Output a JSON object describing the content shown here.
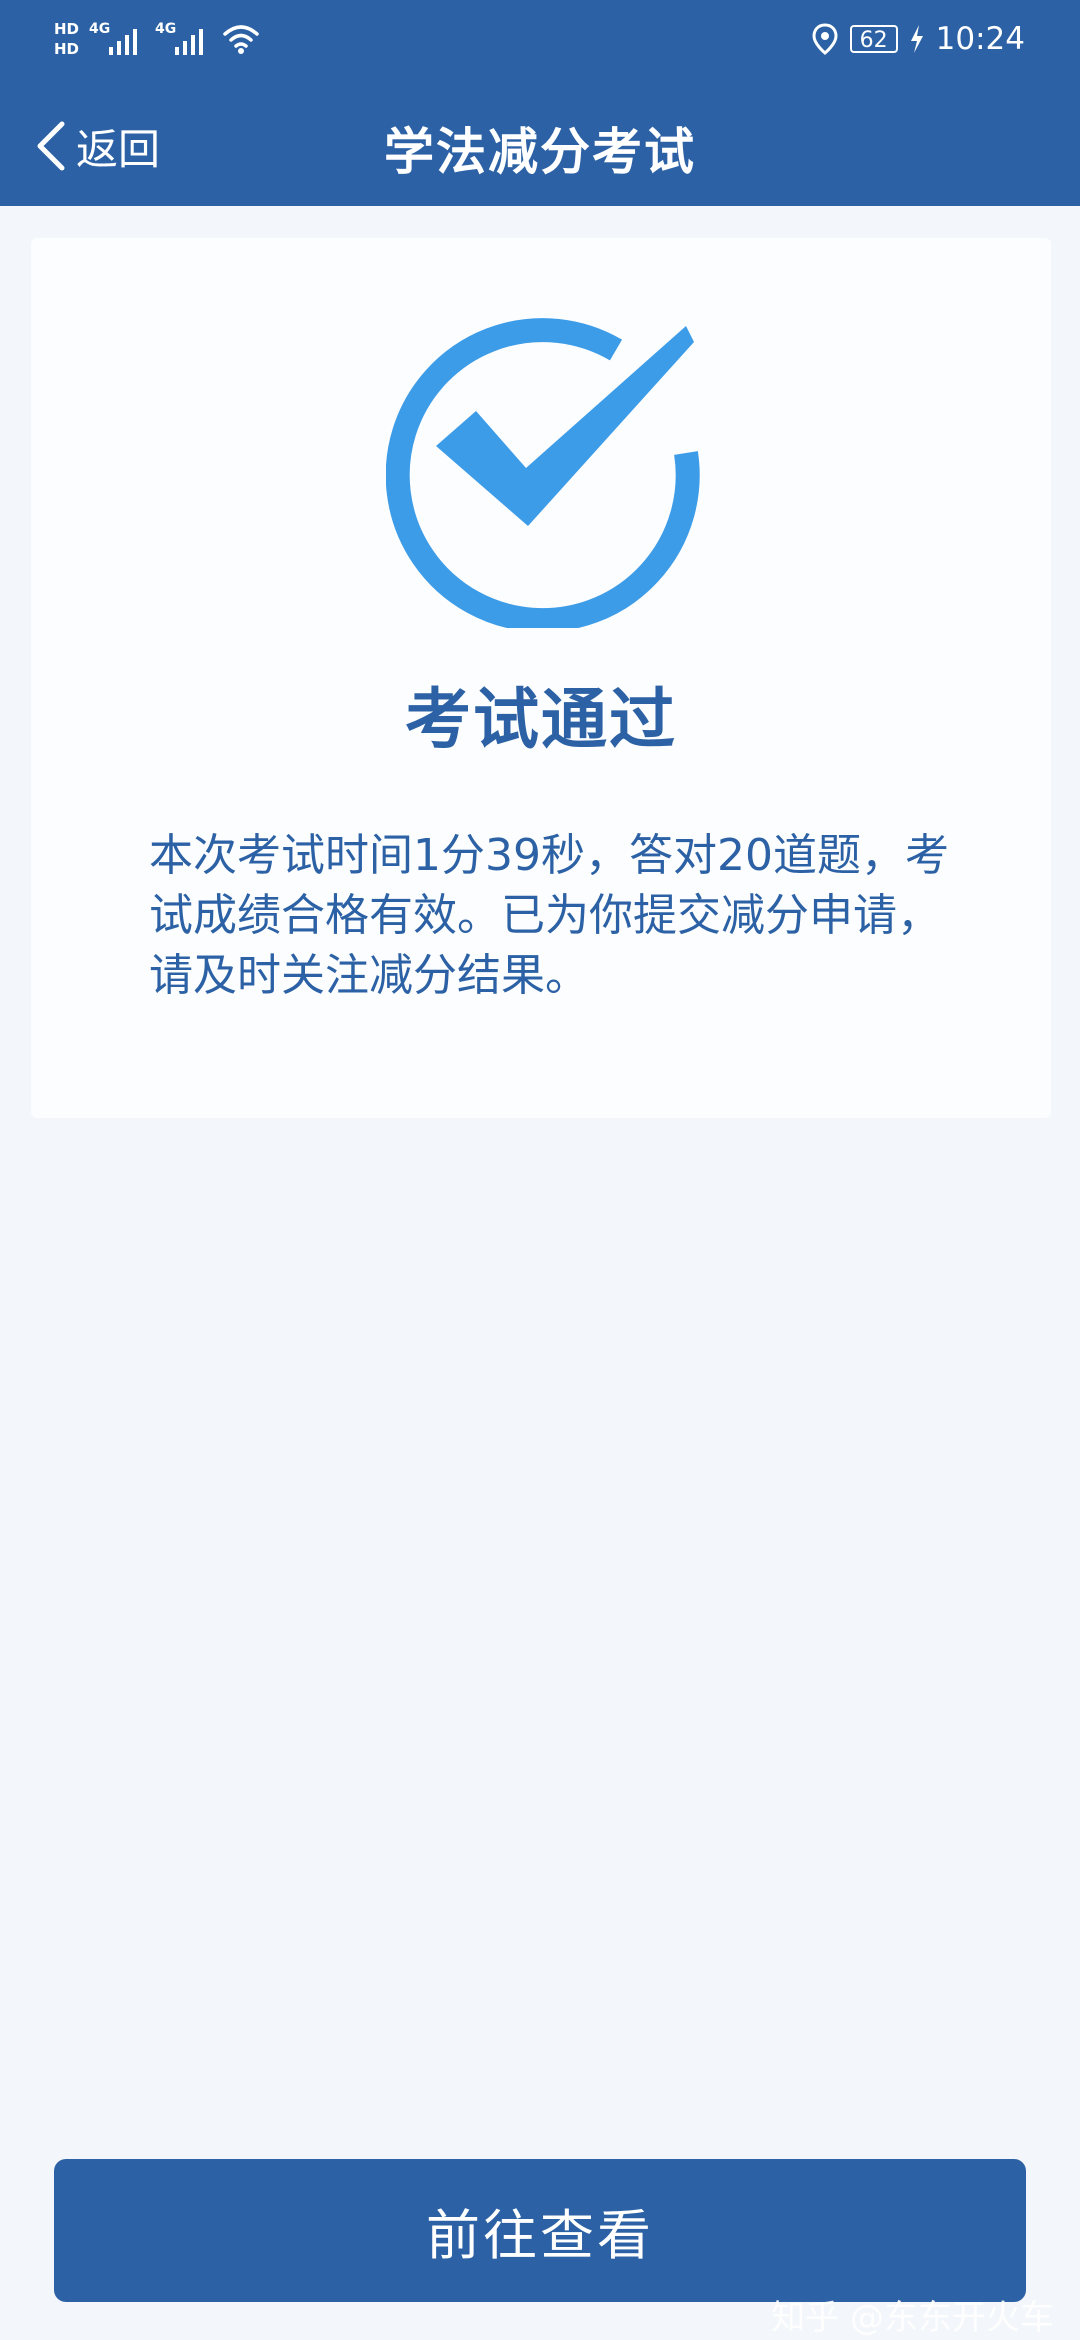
{
  "status_bar": {
    "hd_top": "HD",
    "hd_bottom": "HD",
    "network_1": "4G",
    "network_2": "4G",
    "battery": "62",
    "time": "10:24"
  },
  "header": {
    "back_label": "返回",
    "title": "学法减分考试"
  },
  "result": {
    "title": "考试通过",
    "description": "本次考试时间1分39秒，答对20道题，考试成绩合格有效。已为你提交减分申请，请及时关注减分结果。"
  },
  "actions": {
    "view_label": "前往查看"
  },
  "watermark": "知乎 @东东开火车",
  "colors": {
    "brand": "#2c62a5",
    "check": "#3d9ce8",
    "background": "#f3f6fa"
  },
  "icons": [
    "chevron-left-icon",
    "check-circle-icon",
    "location-icon",
    "charging-icon",
    "wifi-icon",
    "signal-icon"
  ]
}
